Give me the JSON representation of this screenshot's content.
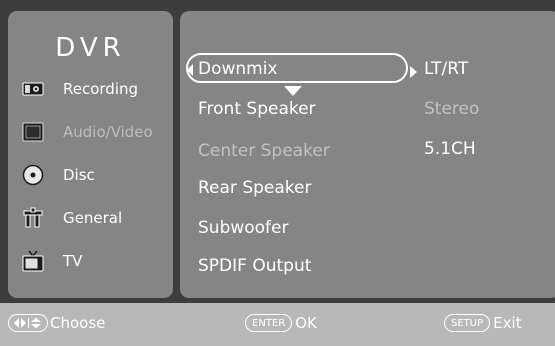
{
  "brand": "DVR",
  "sidebar": {
    "items": [
      {
        "label": "Recording",
        "icon": "tape-deck-icon",
        "active": true
      },
      {
        "label": "Audio/Video",
        "icon": "monitor-icon",
        "active": false
      },
      {
        "label": "Disc",
        "icon": "disc-icon",
        "active": true
      },
      {
        "label": "General",
        "icon": "tools-icon",
        "active": true
      },
      {
        "label": "TV",
        "icon": "tv-icon",
        "active": true
      }
    ]
  },
  "settings": [
    {
      "label": "Downmix",
      "value": "LT/RT",
      "selected": true
    },
    {
      "label": "Front Speaker",
      "value": "Stereo",
      "value_dim": true
    },
    {
      "label": "Center Speaker",
      "value": "5.1CH",
      "label_dim": true
    },
    {
      "label": "Rear Speaker",
      "value": ""
    },
    {
      "label": "Subwoofer",
      "value": ""
    },
    {
      "label": "SPDIF Output",
      "value": ""
    }
  ],
  "footer": {
    "choose_label": "Choose",
    "enter_key": "ENTER",
    "ok_label": "OK",
    "setup_key": "SETUP",
    "exit_label": "Exit"
  },
  "colors": {
    "frame": "#3d3d3d",
    "panel": "#858585",
    "hint_bar": "#b8b8b8",
    "text": "#ffffff",
    "text_dim": "#c2c2c2"
  }
}
